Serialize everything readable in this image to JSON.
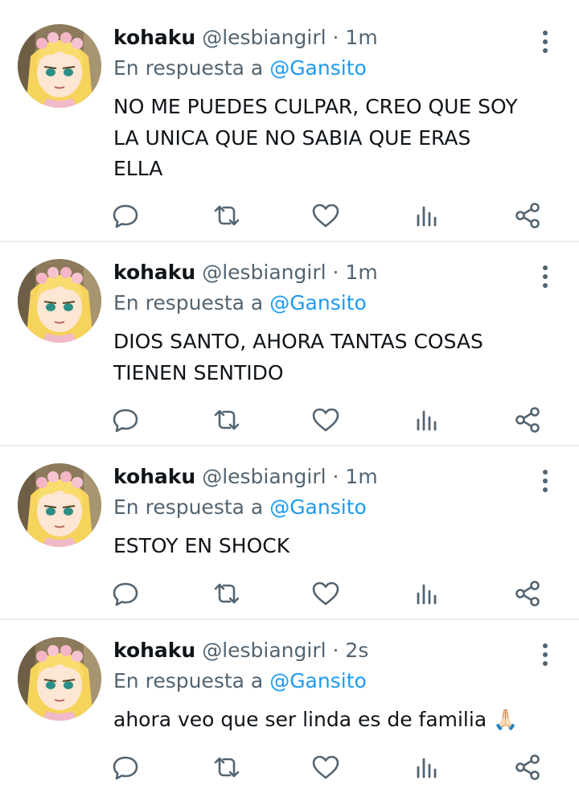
{
  "icons": {
    "reply": "reply-icon",
    "retweet": "retweet-icon",
    "like": "heart-icon",
    "views": "analytics-icon",
    "share": "share-icon",
    "more": "more-vertical-icon"
  },
  "colors": {
    "accent": "#1d9bf0",
    "secondary_text": "#536471",
    "divider": "#e8ecef"
  },
  "tweets": [
    {
      "name": "kohaku",
      "handle": "@lesbiangirl",
      "sep": "·",
      "time": "1m",
      "reply_prefix": "En respuesta a ",
      "reply_to": "@Gansito",
      "lines": [
        "NO ME PUEDES CULPAR, CREO QUE SOY",
        "LA UNICA QUE NO SABIA QUE ERAS",
        "ELLA"
      ]
    },
    {
      "name": "kohaku",
      "handle": "@lesbiangirl",
      "sep": "·",
      "time": "1m",
      "reply_prefix": "En respuesta a ",
      "reply_to": "@Gansito",
      "lines": [
        "DIOS SANTO, AHORA TANTAS COSAS",
        "TIENEN SENTIDO"
      ]
    },
    {
      "name": "kohaku",
      "handle": "@lesbiangirl",
      "sep": "·",
      "time": "1m",
      "reply_prefix": "En respuesta a ",
      "reply_to": "@Gansito",
      "lines": [
        "ESTOY EN SHOCK"
      ]
    },
    {
      "name": "kohaku",
      "handle": "@lesbiangirl",
      "sep": "·",
      "time": "2s",
      "reply_prefix": "En respuesta a ",
      "reply_to": "@Gansito",
      "lines": [
        "ahora veo que ser linda es de familia 🙏🏻"
      ]
    }
  ]
}
